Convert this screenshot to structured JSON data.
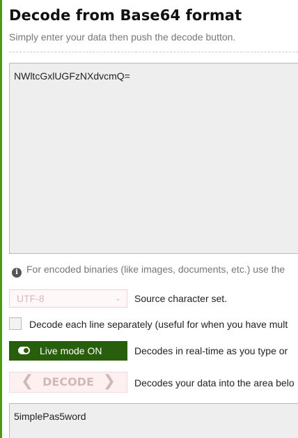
{
  "colors": {
    "accent_green": "#4a9a14",
    "live_button_bg": "#285e0c",
    "textarea_bg": "#eeeeee"
  },
  "header": {
    "title": "Decode from Base64 format",
    "subtitle": "Simply enter your data then push the decode button."
  },
  "input": {
    "value": "NWltcGxlUGFzNXdvcmQ="
  },
  "info": {
    "icon": "info-icon",
    "text": "For encoded binaries (like images, documents, etc.) use the"
  },
  "charset": {
    "selected": "UTF-8",
    "icon": "chevron-down-icon",
    "label": "Source character set."
  },
  "line_option": {
    "checked": false,
    "label": "Decode each line separately (useful for when you have mult"
  },
  "live_mode": {
    "icon": "toggle-icon",
    "label": "Live mode ON",
    "description": "Decodes in real-time as you type or"
  },
  "decode": {
    "label": "DECODE",
    "icon_left": "chevron-left-icon",
    "icon_right": "chevron-right-icon",
    "description": "Decodes your data into the area belo"
  },
  "output": {
    "value": "5implePas5word"
  }
}
